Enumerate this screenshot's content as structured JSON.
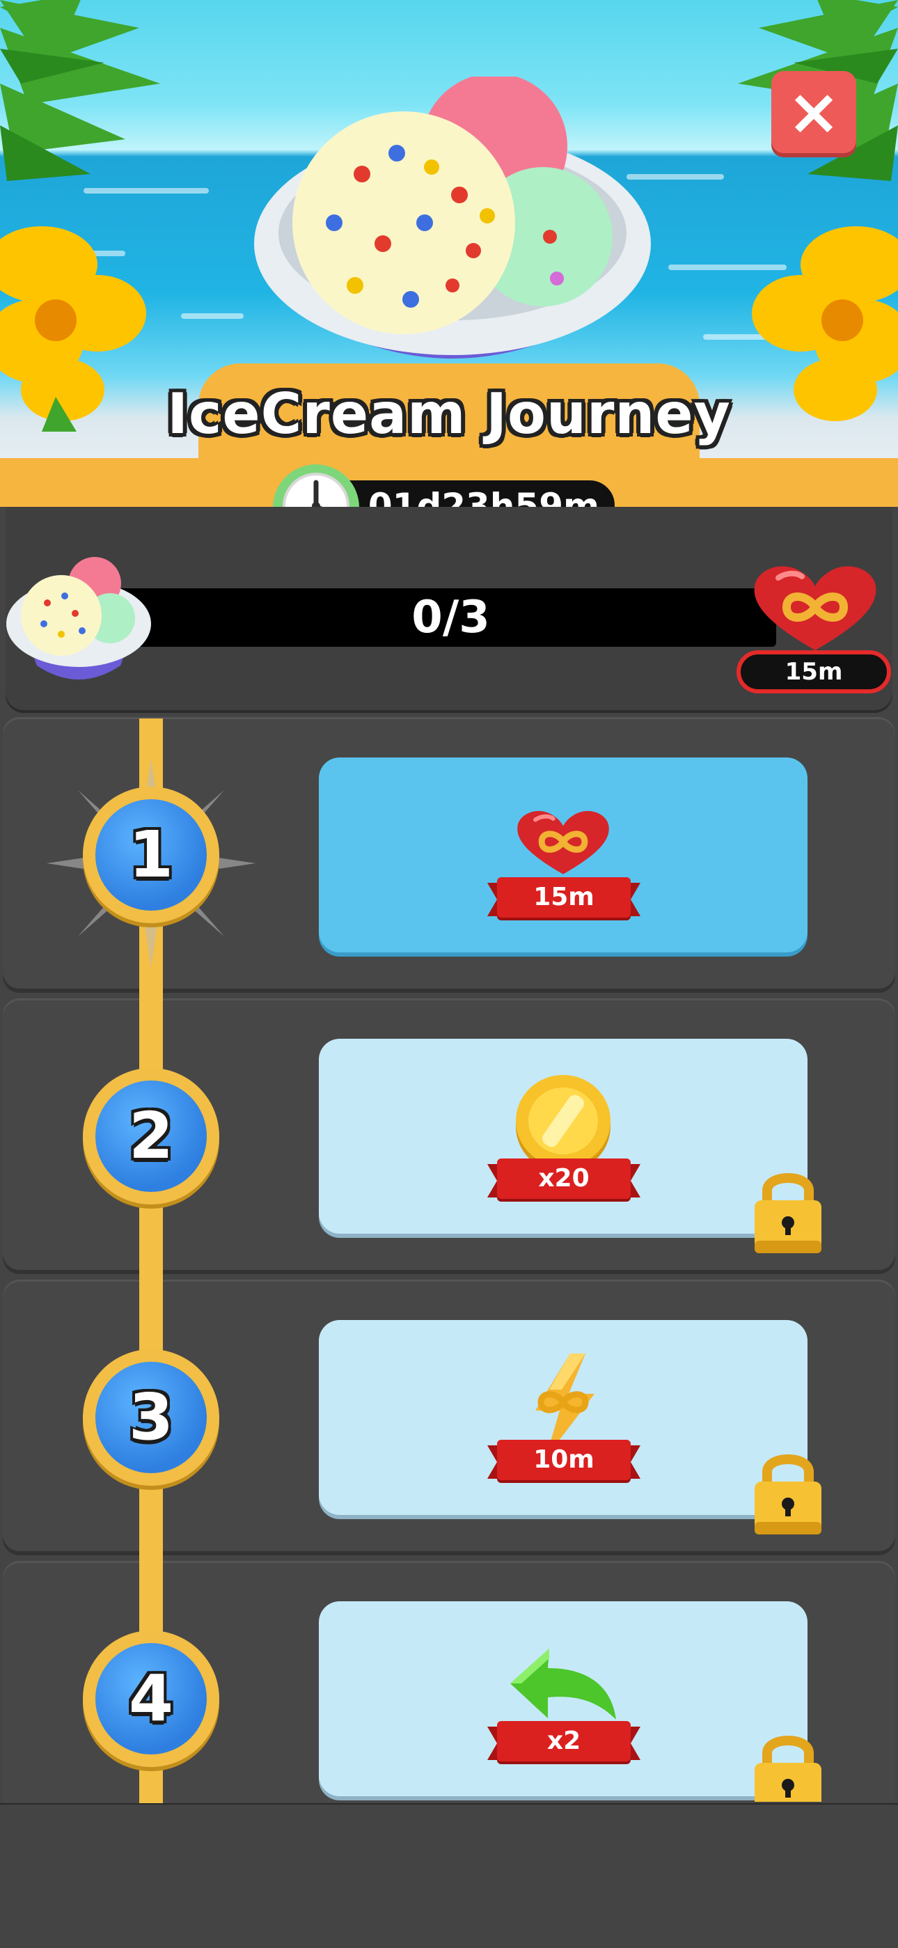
{
  "header": {
    "title": "IceCream Journey",
    "close_glyph": "×",
    "countdown": "01d23h59m"
  },
  "progress": {
    "label": "0/3",
    "current": 0,
    "total": 3,
    "reward_badge": "15m",
    "reward_icon": "infinite-heart-icon"
  },
  "steps": [
    {
      "number": "1",
      "reward_label": "15m",
      "reward_icon": "infinite-heart-icon",
      "state": "active"
    },
    {
      "number": "2",
      "reward_label": "x20",
      "reward_icon": "gold-coin-icon",
      "state": "locked"
    },
    {
      "number": "3",
      "reward_label": "10m",
      "reward_icon": "infinite-lightning-icon",
      "state": "locked"
    },
    {
      "number": "4",
      "reward_label": "x2",
      "reward_icon": "undo-arrow-icon",
      "state": "locked"
    }
  ],
  "colors": {
    "accent": "#f6b53f",
    "panel": "#474747",
    "active_card": "#5ac4ef",
    "locked_card": "#c6e9f7",
    "ribbon": "#db2020",
    "close": "#ee5a57"
  }
}
